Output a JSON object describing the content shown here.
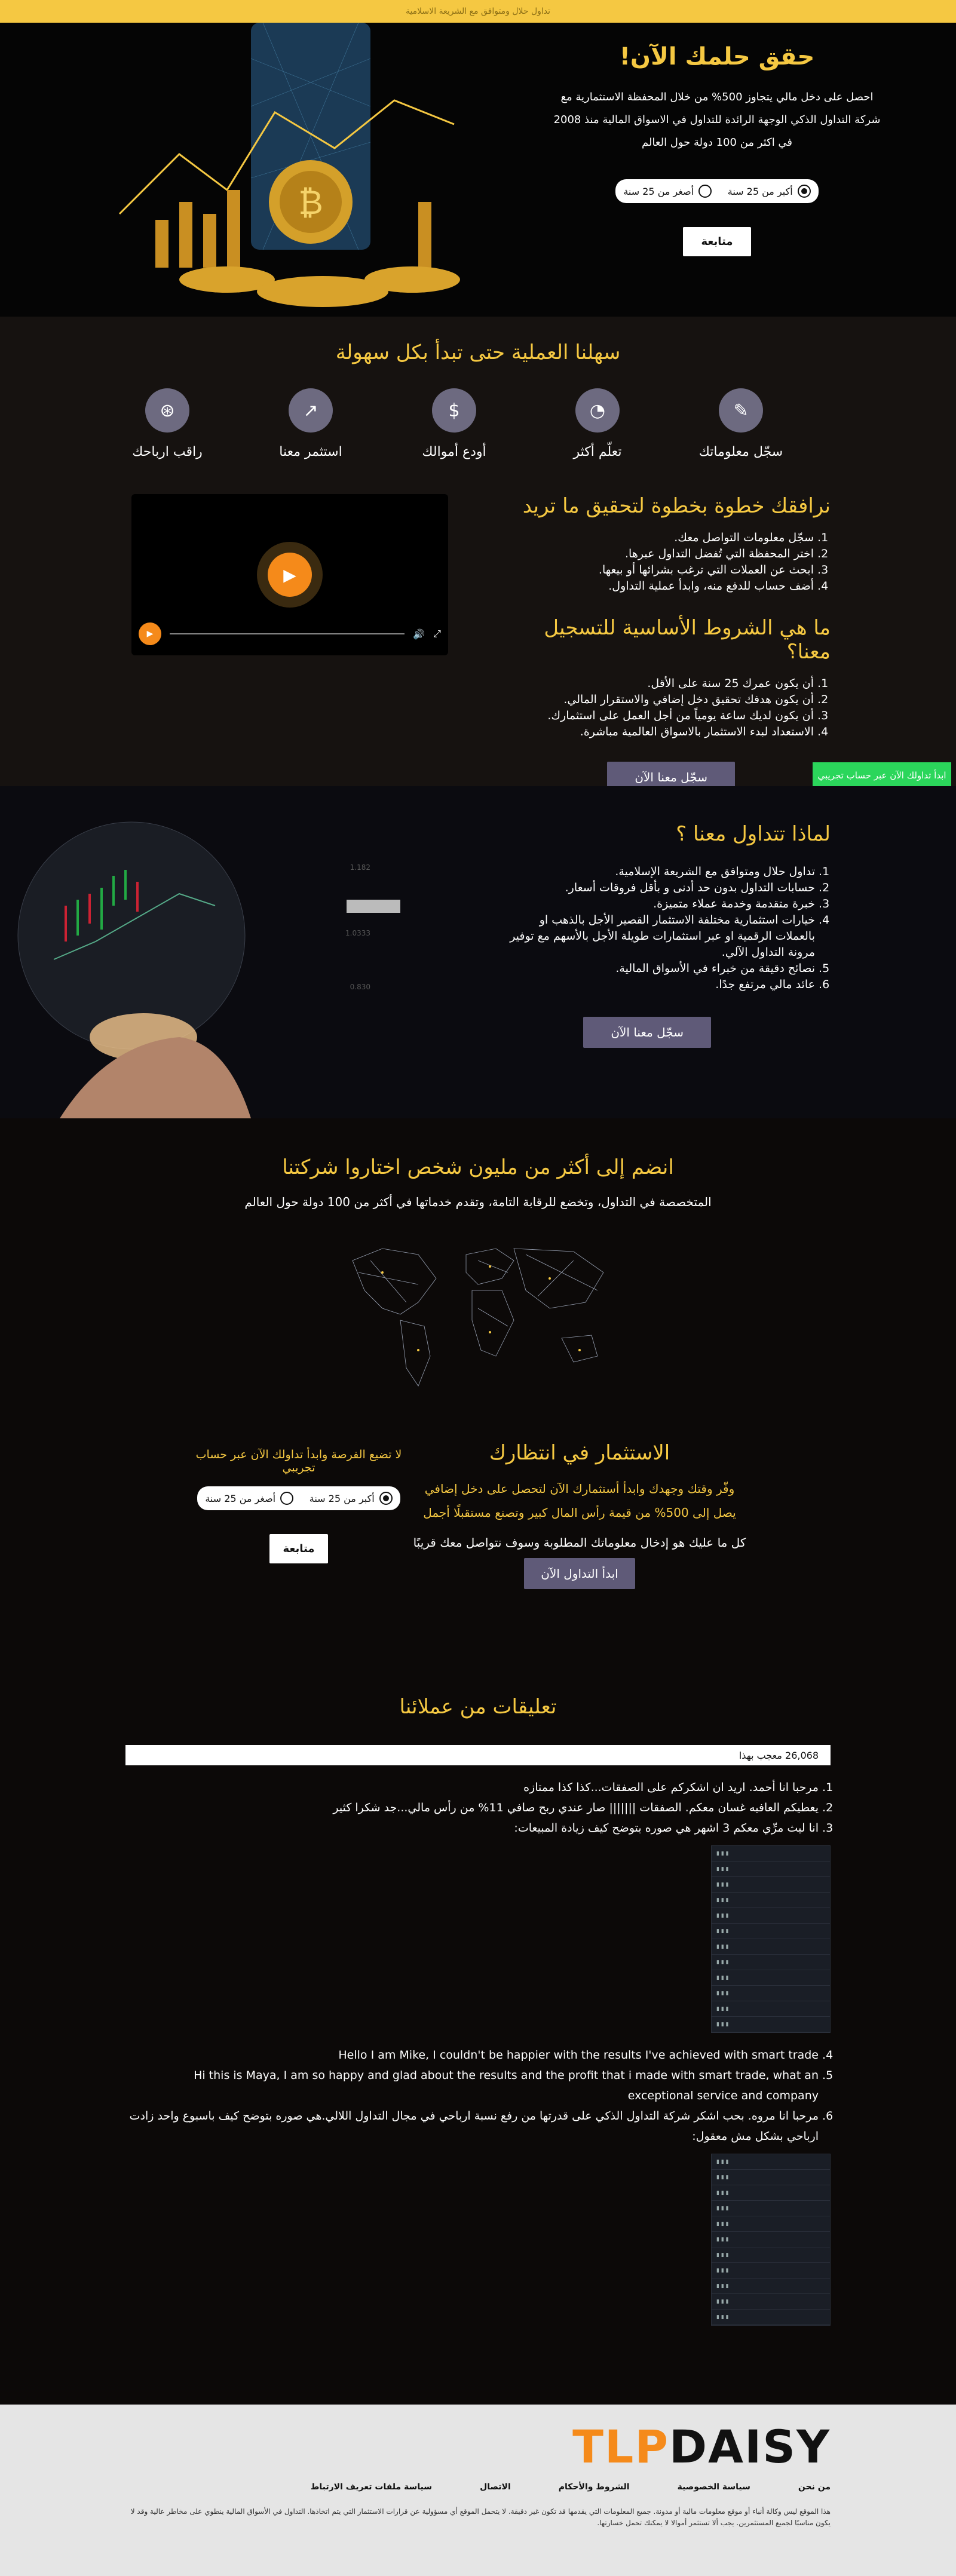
{
  "topbar": {
    "text": "تداول حلال ومتوافق مع الشريعة الاسلامية"
  },
  "hero": {
    "title": "حقق حلمك الآن!",
    "text": "احصل على دخل مالي يتجاوز 500% من خلال المحفظة الاستثمارية مع شركة التداول الذكي الوجهة الرائدة للتداول في الاسواق المالية منذ 2008 في اكثر من 100 دولة حول العالم",
    "opt_over": "أكبر من 25 سنة",
    "opt_under": "أصغر من 25 سنة",
    "button": "متابعة"
  },
  "how": {
    "title": "سهلنا العملية حتى تبدأ بكل سهولة",
    "steps": [
      {
        "label": "سجّل معلوماتك",
        "icon": "tools-icon"
      },
      {
        "label": "تعلّم أكثر",
        "icon": "pie-chart-icon"
      },
      {
        "label": "أودع أموالك",
        "icon": "money-icon"
      },
      {
        "label": "استثمر معنا",
        "icon": "line-chart-icon"
      },
      {
        "label": "راقب ارباحك",
        "icon": "dollar-search-icon"
      }
    ],
    "demo_button": "ابدأ تداولك الآن عبر حساب تجريبي",
    "step_title": "نرافقك خطوة بخطوة لتحقيق ما تريد",
    "step_items": [
      "سجّل معلومات التواصل معك.",
      "اختر المحفظة التي تُفضل التداول عبرها.",
      "ابحث عن العملات التي ترغب بشرائها أو بيعها.",
      "أضف حساب للدفع منه، وابدأ عملية التداول."
    ],
    "req_title": "ما هي الشروط الأساسية للتسجيل معنا؟",
    "req_items": [
      "أن يكون عمرك 25 سنة على الأقل.",
      "أن يكون هدفك تحقيق دخل إضافي والاستقرار المالي.",
      "أن يكون لديك ساعة يومياً من أجل العمل على استثمارك.",
      "الاستعداد لبدء الاستثمار بالاسواق العالمية مباشرة."
    ],
    "register": "سجّل معنا الآن"
  },
  "why": {
    "title": "لماذا تتداول معنا ؟",
    "items": [
      "تداول حلال ومتوافق مع الشريعة الإسلامية.",
      "حسابات التداول بدون حد أدنى و بأقل فروقات أسعار.",
      "خبرة متقدمة وخدمة عملاء متميزة.",
      "خيارات استثمارية مختلفة الاستثمار القصير الأجل بالذهب او بالعملات الرقمية او عبر استثمارات طويلة الأجل بالأسهم مع توفير مرونة التداول الآلي.",
      "نصائح دقيقة من خبراء في الأسواق المالية.",
      "عائد مالي مرتفع جدًا."
    ],
    "register": "سجّل معنا الآن"
  },
  "join": {
    "title": "انضم إلى أكثر من مليون شخص اختاروا شركتنا",
    "text": "المتخصصة في التداول، وتخضع للرقابة التامة، وتقدم خدماتها في أكثر من 100 دولة حول العالم"
  },
  "invest": {
    "title": "الاستثمار في انتظارك",
    "yellow": "وفّر وقتك وجهدك وابدأ أستثمارك الآن لتحصل على دخل إضافي يصل إلى 500% من قيمة رأس المال كبير وتصنع مستقبلًا أجمل",
    "white": "كل ما عليك هو إدخال معلوماتك المطلوبة وسوف نتواصل معك قريبًا",
    "button": "ابدأ التداول الآن",
    "left_text": "لا تضيع الفرصة وابدأ تداولك الآن عبر حساب تجريبي",
    "opt_over": "أكبر من 25 سنة",
    "opt_under": "أصغر من 25 سنة",
    "continue": "متابعة"
  },
  "reviews": {
    "title": "تعليقات من عملائنا",
    "likes": "26,068 معجب بهذا",
    "items": [
      "مرحبا انا أحمد. اريد ان اشكركم على الصفقات...كذا كذا ممتازه",
      "يعطيكم العافيه غسان معكم. الصفقات ||||||| صار عندي ربح صافي 11% من رأس مالي...جد شكرا كثير",
      "انا ليث مرِّي معكم 3 اشهر هي صوره بتوضح كيف زيادة المبيعات:",
      "Hello I am Mike, I couldn't be happier with the results I've achieved with smart trade",
      "Hi this is Maya, I am so happy and glad about the results and the profit that i made with smart trade, what an exceptional service and company",
      "مرحبا انا مروه. بحب اشكر شركة التداول الذكي على قدرتها من رفع نسبة ارباحي في مجال التداول اللالي.هي صوره بتوضح كيف باسبوع واحد زادت ارباحي بشكل مش معقول:"
    ]
  },
  "footer": {
    "logo_a": "TLP",
    "logo_b": "DAISY",
    "links": [
      "من نحن",
      "سياسة الخصوصية",
      "الشروط والأحكام",
      "الاتصال",
      "سياسة ملفات تعريف الارتباط"
    ],
    "disclaimer": "هذا الموقع ليس وكالة أنباء أو موقع معلومات مالية أو مدونة. جميع المعلومات التي يقدمها قد تكون غير دقيقة. لا يتحمل الموقع أي مسؤولية عن قرارات الاستثمار التي يتم اتخاذها. التداول في الأسواق المالية ينطوي على مخاطر عالية وقد لا يكون مناسبًا لجميع المستثمرين. يجب ألا تستثمر أموالا لا يمكنك تحمل خسارتها."
  }
}
